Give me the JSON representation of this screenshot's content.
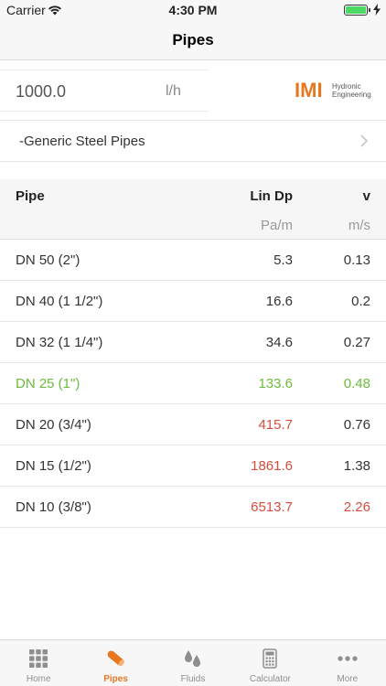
{
  "status": {
    "carrier": "Carrier",
    "time": "4:30 PM"
  },
  "nav": {
    "title": "Pipes"
  },
  "flow": {
    "value": "1000.0",
    "unit": "l/h"
  },
  "logo": {
    "mark": "IMI",
    "line1": "Hydronic",
    "line2": "Engineering"
  },
  "pipe_series": {
    "label": "-Generic Steel Pipes"
  },
  "table": {
    "headers": {
      "pipe": "Pipe",
      "lin_dp": "Lin Dp",
      "v": "v"
    },
    "units": {
      "lin_dp": "Pa/m",
      "v": "m/s"
    },
    "rows": [
      {
        "pipe": "DN 50 (2\")",
        "lin_dp": "5.3",
        "v": "0.13"
      },
      {
        "pipe": "DN 40 (1 1/2\")",
        "lin_dp": "16.6",
        "v": "0.2"
      },
      {
        "pipe": "DN 32 (1 1/4\")",
        "lin_dp": "34.6",
        "v": "0.27"
      },
      {
        "pipe": "DN 25 (1\")",
        "lin_dp": "133.6",
        "v": "0.48"
      },
      {
        "pipe": "DN 20 (3/4\")",
        "lin_dp": "415.7",
        "v": "0.76"
      },
      {
        "pipe": "DN 15 (1/2\")",
        "lin_dp": "1861.6",
        "v": "1.38"
      },
      {
        "pipe": "DN 10 (3/8\")",
        "lin_dp": "6513.7",
        "v": "2.26"
      }
    ]
  },
  "colors": {
    "accent": "#e87722",
    "selected": "#6cbb3c",
    "warning": "#d94c3d"
  },
  "tabs": [
    {
      "label": "Home",
      "icon": "grid-icon"
    },
    {
      "label": "Pipes",
      "icon": "pipe-icon"
    },
    {
      "label": "Fluids",
      "icon": "droplets-icon"
    },
    {
      "label": "Calculator",
      "icon": "calculator-icon"
    },
    {
      "label": "More",
      "icon": "more-icon"
    }
  ]
}
